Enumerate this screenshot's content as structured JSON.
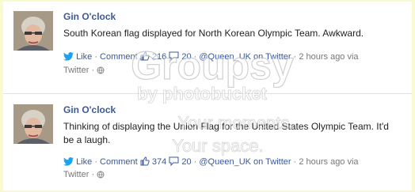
{
  "posts": [
    {
      "author": "Gin O'clock",
      "text": "South Korean flag displayed for North Korean Olympic Team. Awkward.",
      "like_label": "Like",
      "comment_label": "Comment",
      "like_count": "216",
      "comment_count": "20",
      "handle": "@Queen_UK on Twitter",
      "time": "2 hours ago via",
      "source": "Twitter"
    },
    {
      "author": "Gin O'clock",
      "text": "Thinking of displaying the Union Flag for the United States Olympic Team. It'd be a laugh.",
      "like_label": "Like",
      "comment_label": "Comment",
      "like_count": "374",
      "comment_count": "20",
      "handle": "@Queen_UK on Twitter",
      "time": "2 hours ago via",
      "source": "Twitter"
    }
  ],
  "sep": "·",
  "watermark": {
    "brand": "Groupsy",
    "by": "by photobucket",
    "tag1": "Your moments.",
    "tag2": "Your space."
  },
  "colors": {
    "page_bg": "#fafad0",
    "link": "#3b5998",
    "twitter": "#1da1f2",
    "meta": "#777777"
  },
  "icons": {
    "avatar": "avatar-image",
    "twitter": "twitter-bird-icon",
    "like": "thumbs-up-icon",
    "comment": "comment-bubble-icon",
    "globe": "globe-icon"
  }
}
